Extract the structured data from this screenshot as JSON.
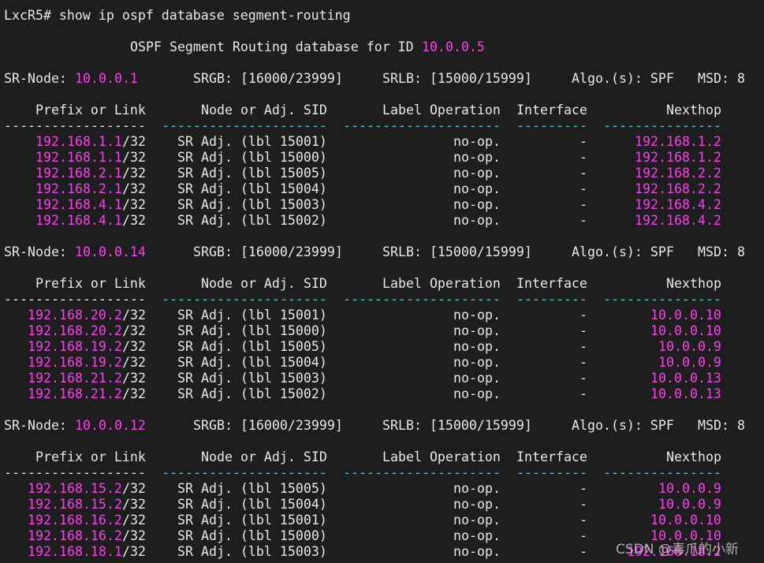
{
  "terminal": {
    "command_line": "LxcR5# show ip ospf database segment-routing",
    "title_prefix": "OSPF Segment Routing database for ID ",
    "router_id": "10.0.0.5",
    "headers": [
      "Prefix or Link",
      "Node or Adj. SID",
      "Label Operation",
      "Interface",
      "Nexthop"
    ],
    "colors": {
      "background": "#1e1e1e",
      "text": "#e8e8e8",
      "highlight": "#ff3cf0",
      "separator": "#4cc4e6"
    },
    "sections": [
      {
        "node_label": "SR-Node: ",
        "node": "10.0.0.1",
        "srgb": "SRGB: [16000/23999]",
        "srlb": "SRLB: [15000/15999]",
        "algo": "Algo.(s): SPF",
        "msd": "MSD: 8",
        "rows": [
          {
            "prefix": "192.168.1.1",
            "mask": "/32",
            "sid": "SR Adj. (lbl 15001)",
            "op": "no-op.",
            "iface": "-",
            "nexthop": "192.168.1.2"
          },
          {
            "prefix": "192.168.1.1",
            "mask": "/32",
            "sid": "SR Adj. (lbl 15000)",
            "op": "no-op.",
            "iface": "-",
            "nexthop": "192.168.1.2"
          },
          {
            "prefix": "192.168.2.1",
            "mask": "/32",
            "sid": "SR Adj. (lbl 15005)",
            "op": "no-op.",
            "iface": "-",
            "nexthop": "192.168.2.2"
          },
          {
            "prefix": "192.168.2.1",
            "mask": "/32",
            "sid": "SR Adj. (lbl 15004)",
            "op": "no-op.",
            "iface": "-",
            "nexthop": "192.168.2.2"
          },
          {
            "prefix": "192.168.4.1",
            "mask": "/32",
            "sid": "SR Adj. (lbl 15003)",
            "op": "no-op.",
            "iface": "-",
            "nexthop": "192.168.4.2"
          },
          {
            "prefix": "192.168.4.1",
            "mask": "/32",
            "sid": "SR Adj. (lbl 15002)",
            "op": "no-op.",
            "iface": "-",
            "nexthop": "192.168.4.2"
          }
        ]
      },
      {
        "node_label": "SR-Node: ",
        "node": "10.0.0.14",
        "srgb": "SRGB: [16000/23999]",
        "srlb": "SRLB: [15000/15999]",
        "algo": "Algo.(s): SPF",
        "msd": "MSD: 8",
        "rows": [
          {
            "prefix": "192.168.20.2",
            "mask": "/32",
            "sid": "SR Adj. (lbl 15001)",
            "op": "no-op.",
            "iface": "-",
            "nexthop": "10.0.0.10"
          },
          {
            "prefix": "192.168.20.2",
            "mask": "/32",
            "sid": "SR Adj. (lbl 15000)",
            "op": "no-op.",
            "iface": "-",
            "nexthop": "10.0.0.10"
          },
          {
            "prefix": "192.168.19.2",
            "mask": "/32",
            "sid": "SR Adj. (lbl 15005)",
            "op": "no-op.",
            "iface": "-",
            "nexthop": "10.0.0.9"
          },
          {
            "prefix": "192.168.19.2",
            "mask": "/32",
            "sid": "SR Adj. (lbl 15004)",
            "op": "no-op.",
            "iface": "-",
            "nexthop": "10.0.0.9"
          },
          {
            "prefix": "192.168.21.2",
            "mask": "/32",
            "sid": "SR Adj. (lbl 15003)",
            "op": "no-op.",
            "iface": "-",
            "nexthop": "10.0.0.13"
          },
          {
            "prefix": "192.168.21.2",
            "mask": "/32",
            "sid": "SR Adj. (lbl 15002)",
            "op": "no-op.",
            "iface": "-",
            "nexthop": "10.0.0.13"
          }
        ]
      },
      {
        "node_label": "SR-Node: ",
        "node": "10.0.0.12",
        "srgb": "SRGB: [16000/23999]",
        "srlb": "SRLB: [15000/15999]",
        "algo": "Algo.(s): SPF",
        "msd": "MSD: 8",
        "rows": [
          {
            "prefix": "192.168.15.2",
            "mask": "/32",
            "sid": "SR Adj. (lbl 15005)",
            "op": "no-op.",
            "iface": "-",
            "nexthop": "10.0.0.9"
          },
          {
            "prefix": "192.168.15.2",
            "mask": "/32",
            "sid": "SR Adj. (lbl 15004)",
            "op": "no-op.",
            "iface": "-",
            "nexthop": "10.0.0.9"
          },
          {
            "prefix": "192.168.16.2",
            "mask": "/32",
            "sid": "SR Adj. (lbl 15001)",
            "op": "no-op.",
            "iface": "-",
            "nexthop": "10.0.0.10"
          },
          {
            "prefix": "192.168.16.2",
            "mask": "/32",
            "sid": "SR Adj. (lbl 15000)",
            "op": "no-op.",
            "iface": "-",
            "nexthop": "10.0.0.10"
          },
          {
            "prefix": "192.168.18.1",
            "mask": "/32",
            "sid": "SR Adj. (lbl 15003)",
            "op": "no-op.",
            "iface": "-",
            "nexthop": "192.168.18.2"
          }
        ]
      }
    ]
  },
  "watermark": "CSDN @毒爪的小新"
}
